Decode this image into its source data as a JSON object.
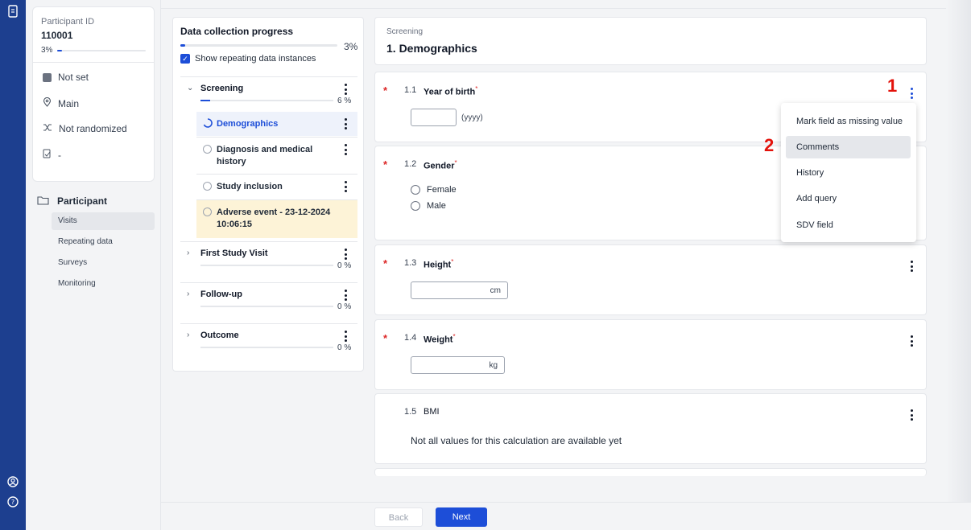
{
  "rail": {
    "icons": [
      "notebook-icon",
      "user-circle-icon",
      "help-icon"
    ]
  },
  "participant": {
    "id_label": "Participant ID",
    "id_value": "110001",
    "progress_text": "3%",
    "progress_fraction": 0.03,
    "status": "Not set",
    "site": "Main",
    "randomization": "Not randomized",
    "extra": "-"
  },
  "nav": {
    "heading": "Participant",
    "items": [
      {
        "label": "Visits",
        "active": true
      },
      {
        "label": "Repeating data",
        "active": false
      },
      {
        "label": "Surveys",
        "active": false
      },
      {
        "label": "Monitoring",
        "active": false
      }
    ]
  },
  "progress": {
    "title": "Data collection progress",
    "percent_text": "3%",
    "fraction": 0.03,
    "show_repeating_label": "Show repeating data instances",
    "show_repeating_checked": true,
    "sections": [
      {
        "name": "Screening",
        "percent_text": "6 %",
        "fraction": 0.06,
        "expanded": true,
        "steps": [
          {
            "label": "Demographics",
            "state": "in-progress"
          },
          {
            "label": "Diagnosis and medical history",
            "state": "empty"
          },
          {
            "label": "Study inclusion",
            "state": "empty"
          },
          {
            "label": "Adverse event - 23-12-2024 10:06:15",
            "state": "repeating"
          }
        ]
      },
      {
        "name": "First Study Visit",
        "percent_text": "0 %",
        "fraction": 0,
        "expanded": false
      },
      {
        "name": "Follow-up",
        "percent_text": "0 %",
        "fraction": 0,
        "expanded": false
      },
      {
        "name": "Outcome",
        "percent_text": "0 %",
        "fraction": 0,
        "expanded": false
      }
    ]
  },
  "form": {
    "section": "Screening",
    "title": "1. Demographics",
    "fields": [
      {
        "num": "1.1",
        "label": "Year of birth",
        "required": true,
        "unit": "(yyyy)",
        "value": ""
      },
      {
        "num": "1.2",
        "label": "Gender",
        "required": true,
        "options": [
          "Female",
          "Male"
        ]
      },
      {
        "num": "1.3",
        "label": "Height",
        "required": true,
        "unit": "cm",
        "value": ""
      },
      {
        "num": "1.4",
        "label": "Weight",
        "required": true,
        "unit": "kg",
        "value": ""
      },
      {
        "num": "1.5",
        "label": "BMI",
        "required": false,
        "message": "Not all values for this calculation are available yet"
      }
    ]
  },
  "menu": {
    "items": [
      "Mark field as missing value",
      "Comments",
      "History",
      "Add query",
      "SDV field"
    ],
    "highlighted": "Comments"
  },
  "annotations": {
    "one": "1",
    "two": "2"
  },
  "footer": {
    "back": "Back",
    "next": "Next"
  },
  "colors": {
    "accent": "#1d4ed8",
    "rail": "#1d3f8f",
    "required": "#dc2626",
    "annotation": "#e3120b",
    "repeating_bg": "#fdf3d7",
    "current_bg": "#eef2fb"
  }
}
